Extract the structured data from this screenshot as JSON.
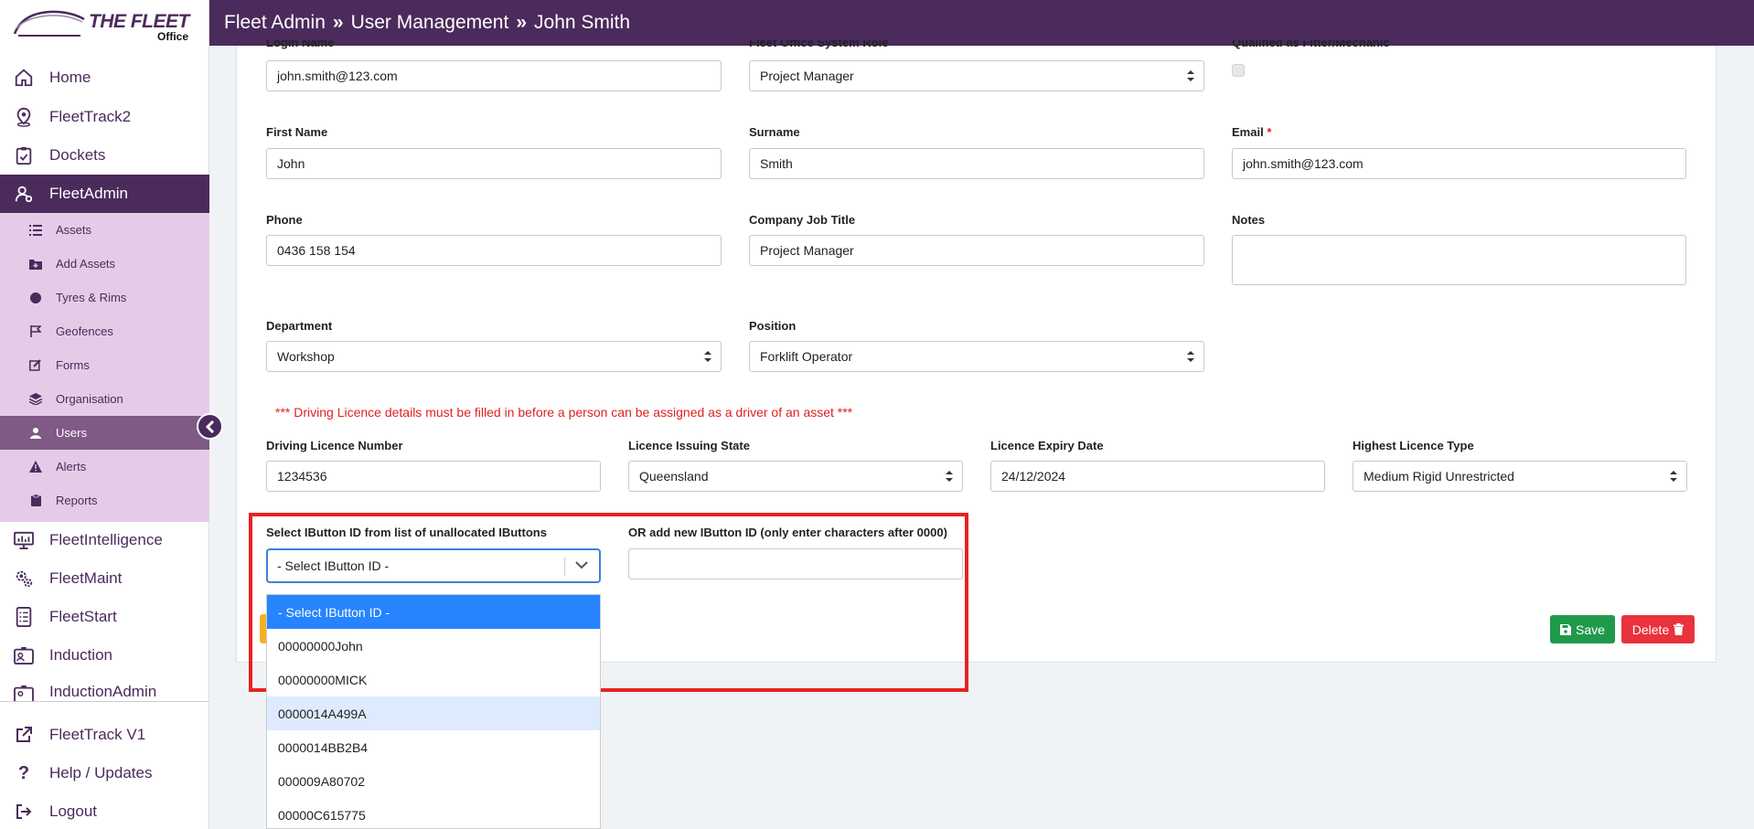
{
  "app": {
    "logo_text": "THE FLEET",
    "logo_sub": "Office",
    "breadcrumb": [
      "Fleet Admin",
      "User Management",
      "John Smith"
    ]
  },
  "sidebar": {
    "main_items": [
      {
        "label": "Home",
        "icon": "home-icon"
      },
      {
        "label": "FleetTrack2",
        "icon": "map-pin-icon"
      },
      {
        "label": "Dockets",
        "icon": "clipboard-check-icon"
      },
      {
        "label": "FleetAdmin",
        "icon": "user-gear-icon",
        "active": true
      }
    ],
    "sub_items": [
      {
        "label": "Assets",
        "icon": "list-icon"
      },
      {
        "label": "Add Assets",
        "icon": "folder-plus-icon"
      },
      {
        "label": "Tyres & Rims",
        "icon": "circle-icon"
      },
      {
        "label": "Geofences",
        "icon": "flag-icon"
      },
      {
        "label": "Forms",
        "icon": "edit-icon"
      },
      {
        "label": "Organisation",
        "icon": "layers-icon"
      },
      {
        "label": "Users",
        "icon": "user-icon",
        "active": true
      },
      {
        "label": "Alerts",
        "icon": "warning-icon"
      },
      {
        "label": "Reports",
        "icon": "clipboard-icon"
      }
    ],
    "lower_items": [
      {
        "label": "FleetIntelligence",
        "icon": "monitor-chart-icon"
      },
      {
        "label": "FleetMaint",
        "icon": "gears-icon"
      },
      {
        "label": "FleetStart",
        "icon": "phone-checklist-icon"
      },
      {
        "label": "Induction",
        "icon": "id-card-icon"
      },
      {
        "label": "InductionAdmin",
        "icon": "id-card-gear-icon"
      }
    ],
    "bottom_items": [
      {
        "label": "FleetTrack V1",
        "icon": "external-link-icon"
      },
      {
        "label": "Help / Updates",
        "icon": "question-icon"
      },
      {
        "label": "Logout",
        "icon": "logout-icon"
      }
    ]
  },
  "form": {
    "login_name": {
      "label": "Login Name",
      "value": "john.smith@123.com"
    },
    "system_role": {
      "label": "Fleet Office System Role",
      "value": "Project Manager"
    },
    "qualified": {
      "label": "Qualified as Fitter/Mechanic"
    },
    "first_name": {
      "label": "First Name",
      "value": "John"
    },
    "surname": {
      "label": "Surname",
      "value": "Smith"
    },
    "email": {
      "label": "Email",
      "required_mark": "*",
      "value": "john.smith@123.com"
    },
    "phone": {
      "label": "Phone",
      "value": "0436 158 154"
    },
    "job_title": {
      "label": "Company Job Title",
      "value": "Project Manager"
    },
    "notes": {
      "label": "Notes",
      "value": ""
    },
    "department": {
      "label": "Department",
      "value": "Workshop"
    },
    "position": {
      "label": "Position",
      "value": "Forklift Operator"
    },
    "licence_warning": "*** Driving Licence details must be filled in before a person can be assigned as a driver of an asset ***",
    "licence_number": {
      "label": "Driving Licence Number",
      "value": "1234536"
    },
    "licence_state": {
      "label": "Licence Issuing State",
      "value": "Queensland"
    },
    "licence_expiry": {
      "label": "Licence Expiry Date",
      "value": "24/12/2024"
    },
    "licence_type": {
      "label": "Highest Licence Type",
      "value": "Medium Rigid Unrestricted"
    },
    "ibutton_select": {
      "label": "Select IButton ID from list of unallocated IButtons",
      "value": "- Select IButton ID -",
      "options": [
        "- Select IButton ID -",
        "00000000John",
        "00000000MICK",
        "0000014A499A",
        "0000014BB2B4",
        "000009A80702",
        "00000C615775"
      ]
    },
    "ibutton_new": {
      "label": "OR add new IButton ID (only enter characters after 0000)",
      "value": ""
    }
  },
  "actions": {
    "save_label": "Save",
    "delete_label": "Delete"
  },
  "colors": {
    "brand": "#4b2a5c",
    "submenu_bg": "#e6cbe8",
    "save": "#1f9a4a",
    "delete": "#e8323c",
    "highlight": "#e82222"
  }
}
